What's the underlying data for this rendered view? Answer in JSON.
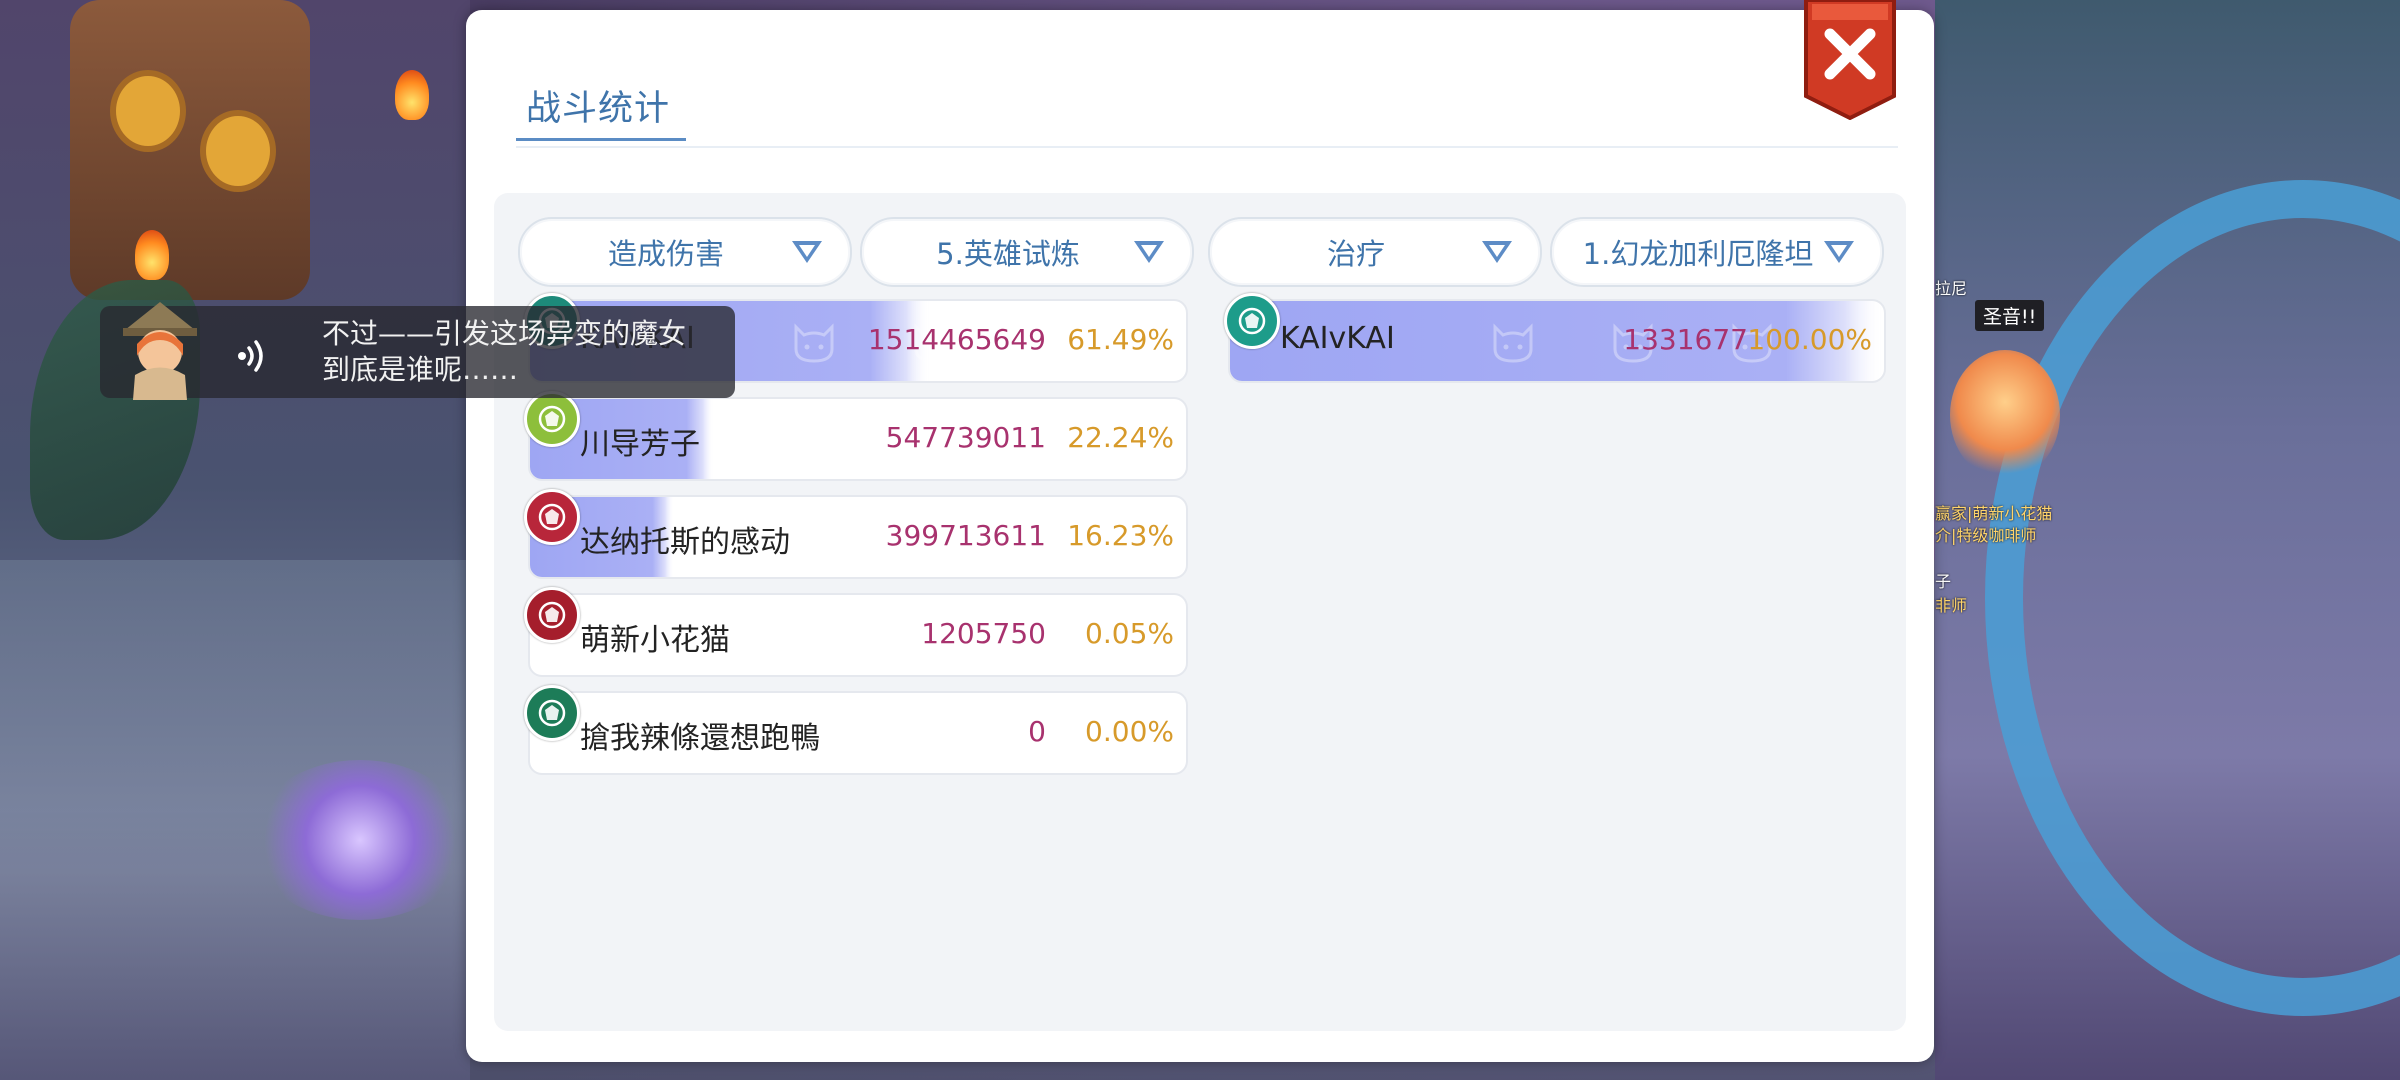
{
  "window": {
    "title": "战斗统计"
  },
  "filters": {
    "left_stat": "造成伤害",
    "left_stage": "5.英雄试炼",
    "right_stat": "治疗",
    "right_stage": "1.幻龙加利厄隆坦"
  },
  "damage_rows": [
    {
      "name": "KAIvKAI",
      "value": "1514465649",
      "percent": "61.49%",
      "fill": 0.61,
      "badge_color": "#1d8a7a"
    },
    {
      "name": "川导芳子",
      "value": "547739011",
      "percent": "22.24%",
      "fill": 0.28,
      "badge_color": "#8dbf3b"
    },
    {
      "name": "达纳托斯的感动",
      "value": "399713611",
      "percent": "16.23%",
      "fill": 0.22,
      "badge_color": "#b8263a"
    },
    {
      "name": "萌新小花猫",
      "value": "1205750",
      "percent": "0.05%",
      "fill": 0.0,
      "badge_color": "#a51e2c"
    },
    {
      "name": "搶我辣條還想跑鴨",
      "value": "0",
      "percent": "0.00%",
      "fill": 0.0,
      "badge_color": "#1d7c58"
    }
  ],
  "heal_rows": [
    {
      "name": "KAIvKAI",
      "value": "1331677",
      "percent": "100.00%",
      "fill": 1.0,
      "badge_color": "#1d9c8a"
    }
  ],
  "dialog": {
    "line1": "不过——引发这场异变的魔女",
    "line2": "到底是谁呢……"
  },
  "world": {
    "shout": "圣音!!",
    "npc_label_1": "赢家|萌新小花猫",
    "npc_label_2": "介|特级咖啡师",
    "npc_label_3": "子",
    "npc_label_4": "非师",
    "npc_label_5": "拉尼"
  },
  "icons": {
    "close": "close-icon",
    "dropdown": "triangle-down-icon",
    "voice": "voice-icon",
    "row_watermark": "cat-icon"
  }
}
